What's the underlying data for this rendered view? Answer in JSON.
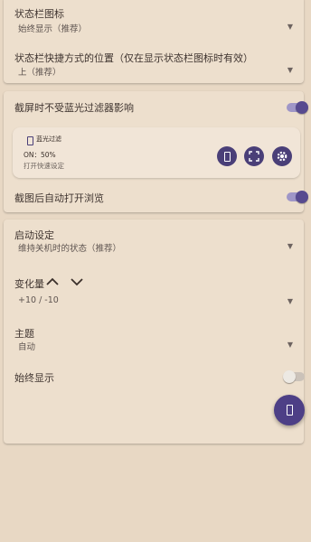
{
  "settings": {
    "statusbar_icon": {
      "label": "状态栏图标",
      "value": "始终显示（推荐）"
    },
    "shortcut_position": {
      "label": "状态栏快捷方式的位置（仅在显示状态栏图标时有效）",
      "value": "上（推荐）"
    }
  },
  "screenshot": {
    "unaffected_label": "截屏时不受蓝光过滤器影响",
    "unaffected_enabled": true,
    "preview": {
      "app_name": "蓝光过滤",
      "status": "ON：50%",
      "action": "打开快速设定"
    },
    "auto_open_label": "截图后自动打开浏览",
    "auto_open_enabled": true
  },
  "startup": {
    "label": "启动设定",
    "value": "维持关机时的状态（推荐）"
  },
  "change": {
    "label": "变化量",
    "value": "+10 / -10"
  },
  "theme": {
    "label": "主题",
    "value": "自动"
  },
  "always_show": {
    "label": "始终显示",
    "enabled": false
  },
  "colors": {
    "background": "#e8d8c4",
    "card": "#eddfcd",
    "accent": "#4d3f86",
    "toggle_track_on": "#9f96c7"
  }
}
